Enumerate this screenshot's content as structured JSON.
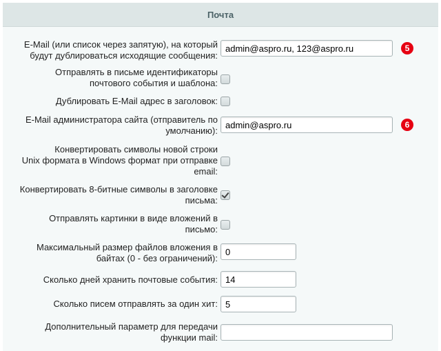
{
  "section": {
    "title": "Почта"
  },
  "fields": {
    "duplicate_email": {
      "label_line1": "E-Mail (или список через запятую), на который",
      "label_line2": "будут дублироваться исходящие сообщения:",
      "value": "admin@aspro.ru, 123@aspro.ru",
      "badge": "5"
    },
    "send_event_ids": {
      "label_line1": "Отправлять в письме идентификаторы",
      "label_line2": "почтового события и шаблона:",
      "checked": false
    },
    "duplicate_header": {
      "label_line1": "Дублировать E-Mail адрес в заголовок:",
      "checked": false
    },
    "admin_email": {
      "label_line1": "E-Mail администратора сайта (отправитель по",
      "label_line2": "умолчанию):",
      "value": "admin@aspro.ru",
      "badge": "6"
    },
    "convert_newlines": {
      "label_line1": "Конвертировать символы новой строки",
      "label_line2": "Unix формата в Windows формат при отправке",
      "label_line3": "email:",
      "checked": false
    },
    "convert_8bit": {
      "label_line1": "Конвертировать 8-битные символы в заголовке",
      "label_line2": "письма:",
      "checked": true
    },
    "images_as_attachments": {
      "label_line1": "Отправлять картинки в виде вложений в",
      "label_line2": "письмо:",
      "checked": false
    },
    "max_attachment_size": {
      "label_line1": "Максимальный размер файлов вложения в",
      "label_line2": "байтах (0 - без ограничений):",
      "value": "0"
    },
    "keep_days": {
      "label_line1": "Сколько дней хранить почтовые события:",
      "value": "14"
    },
    "emails_per_hit": {
      "label_line1": "Сколько писем отправлять за один хит:",
      "value": "5"
    },
    "mail_extra_param": {
      "label_line1": "Дополнительный параметр для передачи",
      "label_line2": "функции mail:",
      "value": ""
    }
  }
}
